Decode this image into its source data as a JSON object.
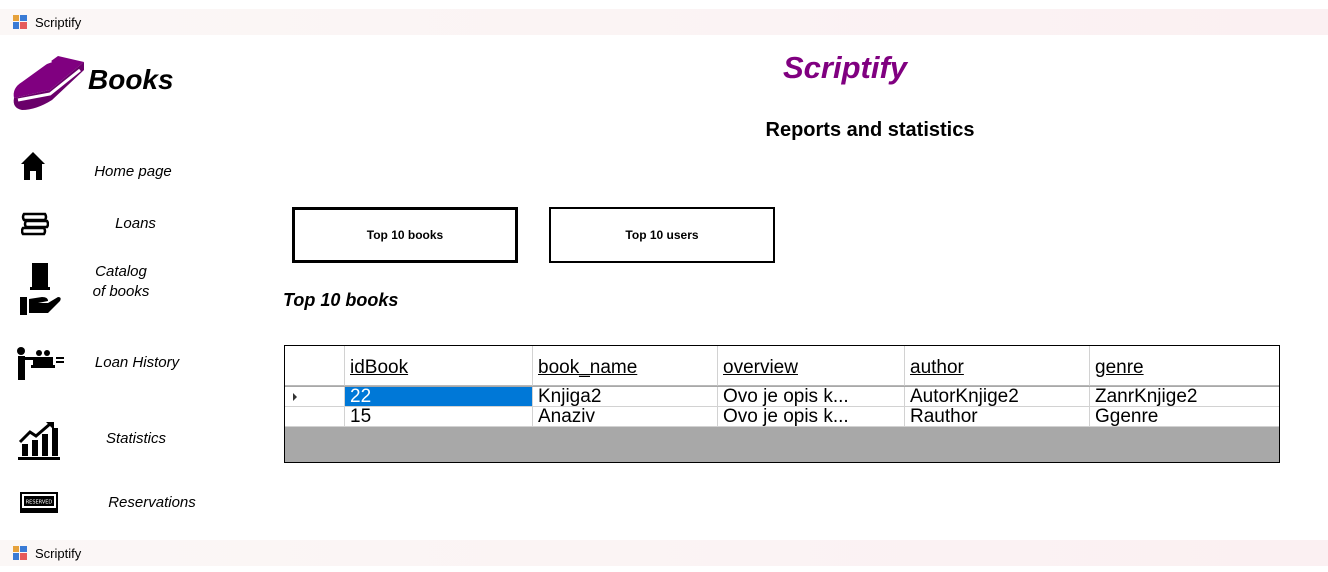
{
  "window": {
    "title": "Scriptify",
    "bottom_title": "Scriptify"
  },
  "sidebar": {
    "logo_text": "Books",
    "items": [
      {
        "label": "Home page",
        "icon": "home-icon"
      },
      {
        "label": "Loans",
        "icon": "books-stack-icon"
      },
      {
        "label": "Catalog of books",
        "icon": "book-in-hand-icon"
      },
      {
        "label": "Loan History",
        "icon": "librarian-icon"
      },
      {
        "label": "Statistics",
        "icon": "chart-icon"
      },
      {
        "label": "Reservations",
        "icon": "reserved-sign-icon"
      }
    ]
  },
  "main": {
    "app_title": "Scriptify",
    "page_title": "Reports and statistics",
    "buttons": {
      "top_books": "Top 10 books",
      "top_users": "Top 10 users"
    },
    "section_title": "Top 10 books",
    "table": {
      "columns": [
        "idBook",
        "book_name",
        "overview",
        "author",
        "genre"
      ],
      "rows": [
        [
          "22",
          "Knjiga2",
          "Ovo je opis k...",
          "AutorKnjige2",
          "ZanrKnjige2"
        ],
        [
          "15",
          "Anaziv",
          "Ovo je opis k...",
          "Rauthor",
          "Ggenre"
        ]
      ]
    }
  },
  "colors": {
    "accent": "#800080",
    "selection": "#0078d7",
    "grid_background": "#a8a8a8"
  }
}
